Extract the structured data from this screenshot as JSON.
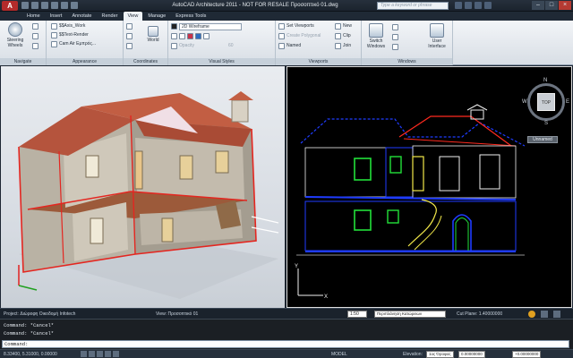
{
  "window": {
    "title": "AutoCAD Architecture 2011 - NOT FOR RESALE  Προσοπτικό 01.dwg",
    "search_placeholder": "Type a keyword or phrase",
    "logo": "A"
  },
  "tabs": [
    "Home",
    "Insert",
    "Annotate",
    "Render",
    "View",
    "Manage",
    "Express Tools"
  ],
  "active_tab": "View",
  "ribbon": {
    "navigate": {
      "title": "Navigate",
      "steering_wheels": "Steering Wheels"
    },
    "appearance": {
      "title": "Appearance",
      "row1": "$$Axis_Work",
      "row2": "$$Text-Render",
      "row3": "Cam Air Εμπρός..."
    },
    "coordinates": {
      "title": "Coordinates",
      "world": "World"
    },
    "visual_styles": {
      "title": "Visual Styles",
      "style": "2D Wireframe",
      "row3": "Opacity",
      "zoom": "60"
    },
    "viewports": {
      "title": "Viewports",
      "set_viewports": "Set Viewports",
      "create_polygonal": "Create Polygonal",
      "named": "Named",
      "new": "New",
      "clip": "Clip",
      "join": "Join"
    },
    "windows": {
      "title": "Windows",
      "switch_windows": "Switch Windows",
      "user_interface": "User Interface"
    }
  },
  "viewcube": {
    "n": "N",
    "s": "S",
    "e": "E",
    "w": "W",
    "top": "TOP",
    "wcs": "Unnamed"
  },
  "status": {
    "project": "Project: Διώροφη Οικοδομή Infotech",
    "view": "View: Προσοπτικό 01",
    "scale": "1:50",
    "layer": "Περιπλάνηση Κατώρειων",
    "cut_plane": "Cut Plane: 1.40000000"
  },
  "command": {
    "line1": "Command: *Cancel*",
    "line2": "Command: *Cancel*",
    "prompt": "Command:"
  },
  "bottom": {
    "coords": "8.33400, 5.31000, 0.00000",
    "model": "MODEL",
    "elevation_label": "Elevation:",
    "elevation_value": "1ος Όροφος",
    "elevation_num": "0.00000000",
    "offset": "+0.00000000"
  },
  "colors": {
    "accent": "#b42b2b",
    "wire_blue": "#1f3cff",
    "wire_red": "#ff2a1f",
    "wire_green": "#22e03a",
    "wire_yellow": "#f2e84a"
  }
}
